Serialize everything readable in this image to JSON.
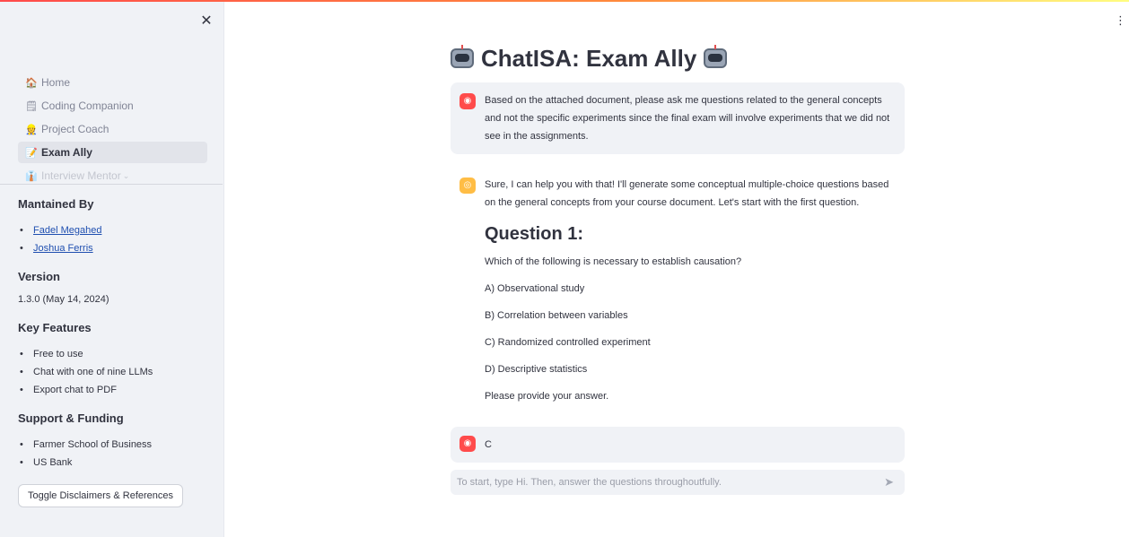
{
  "app": {
    "title": "ChatISA: Exam Ally"
  },
  "sidebar": {
    "close_glyph": "✕",
    "nav": [
      {
        "icon": "🏠",
        "label": "Home"
      },
      {
        "icon": "🗒",
        "label": "Coding Companion"
      },
      {
        "icon": "👷",
        "label": "Project Coach"
      },
      {
        "icon": "📝",
        "label": "Exam Ally",
        "active": true
      },
      {
        "icon": "👔",
        "label": "Interview Mentor"
      }
    ],
    "maintained_heading": "Mantained By",
    "maintainers": [
      "Fadel Megahed",
      "Joshua Ferris"
    ],
    "version_heading": "Version",
    "version": "1.3.0 (May 14, 2024)",
    "features_heading": "Key Features",
    "features": [
      "Free to use",
      "Chat with one of nine LLMs",
      "Export chat to PDF"
    ],
    "support_heading": "Support & Funding",
    "support": [
      "Farmer School of Business",
      "US Bank"
    ],
    "toggle_button": "Toggle Disclaimers & References"
  },
  "chat": {
    "messages": [
      {
        "role": "user",
        "text": "Based on the attached document, please ask me questions related to the general concepts and not the specific experiments since the final exam will involve experiments that we did not see in the assignments."
      },
      {
        "role": "assistant",
        "intro": "Sure, I can help you with that! I'll generate some conceptual multiple-choice questions based on the general concepts from your course document. Let's start with the first question.",
        "question_heading": "Question 1:",
        "question": "Which of the following is necessary to establish causation?",
        "options": [
          "A) Observational study",
          "B) Correlation between variables",
          "C) Randomized controlled experiment",
          "D) Descriptive statistics"
        ],
        "prompt": "Please provide your answer."
      },
      {
        "role": "user",
        "text": "C"
      }
    ],
    "input_placeholder": "To start, type Hi. Then, answer the questions throughoutfully."
  },
  "colors": {
    "accent": "#ff4b4b",
    "bot_avatar": "#ffbd45",
    "sidebar_bg": "#f0f2f6"
  },
  "icons": {
    "user_avatar": "user-avatar-icon",
    "bot_avatar": "bot-avatar-icon",
    "send": "send-icon",
    "menu": "kebab-menu-icon"
  }
}
